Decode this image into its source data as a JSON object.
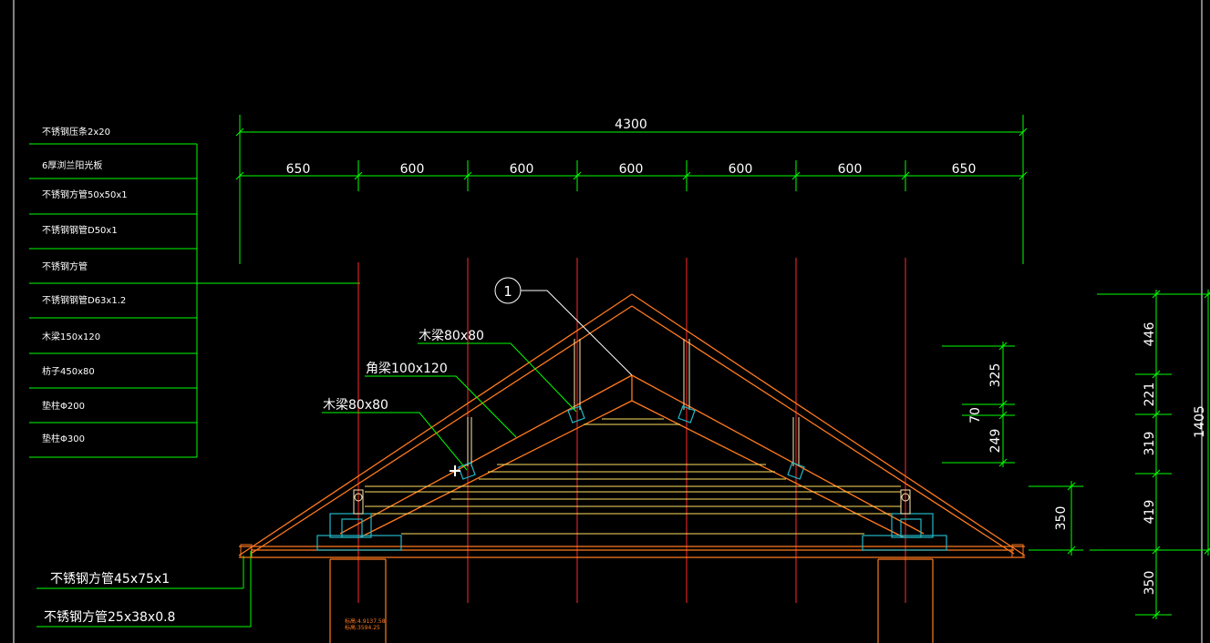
{
  "colors": {
    "background": "#000000",
    "dimension": "#00ff00",
    "roof": "#ff7a1f",
    "axis": "#ff2a2a",
    "purlin": "#ffe060",
    "block": "#22b8c8",
    "text": "#ffffff"
  },
  "legend": [
    "不锈钢压条2x20",
    "6厚浏兰阳光板",
    "不锈钢方管50x50x1",
    "不锈钢钢管D50x1",
    "不锈钢方管",
    "不锈钢钢管D63x1.2",
    "木梁150x120",
    "枋子450x80",
    "垫柱Φ200",
    "垫柱Φ300"
  ],
  "bottom_labels": [
    "不锈钢方管45x75x1",
    "不锈钢方管25x38x0.8"
  ],
  "top_dims": {
    "total": "4300",
    "segments": [
      "650",
      "600",
      "600",
      "600",
      "600",
      "600",
      "650"
    ]
  },
  "callouts": {
    "marker": "1",
    "beam_upper": "木梁80x80",
    "angle_beam": "角梁100x120",
    "beam_lower": "木梁80x80"
  },
  "right_dims": {
    "mid": [
      "325",
      "70",
      "249"
    ],
    "small": "350",
    "outer": [
      "446",
      "221",
      "319",
      "419",
      "350"
    ],
    "total": "1405"
  },
  "column_notes": [
    "标高:4.9137.58",
    "标高:3594.25"
  ]
}
